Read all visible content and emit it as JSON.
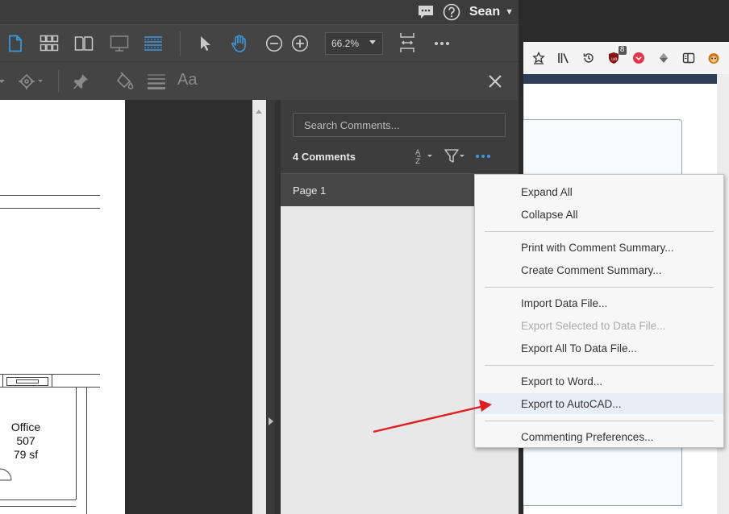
{
  "topbar": {
    "user_name": "Sean",
    "comment_icon": "speech-bubble-icon",
    "help_icon": "help-question-icon"
  },
  "toolbar": {
    "zoom": "66.2%",
    "aa_label": "Aa"
  },
  "document": {
    "room_name": "Office",
    "room_number": "507",
    "room_area": "79 sf"
  },
  "comments_panel": {
    "search_placeholder": "Search Comments...",
    "count_label": "4 Comments",
    "page_label": "Page 1"
  },
  "context_menu": {
    "groups": [
      [
        "Expand All",
        "Collapse All"
      ],
      [
        "Print with Comment Summary...",
        "Create Comment Summary..."
      ],
      [
        "Import Data File...",
        "Export Selected to Data File...",
        "Export All To Data File..."
      ],
      [
        "Export to Word...",
        "Export to AutoCAD..."
      ],
      [
        "Commenting Preferences..."
      ]
    ],
    "disabled_item": "Export Selected to Data File...",
    "highlighted_item": "Export to AutoCAD..."
  },
  "browser": {
    "badge_count": "8"
  },
  "colors": {
    "accent_blue": "#3b98e0",
    "annotation_arrow": "#e02020",
    "panel_dark": "#3d3d3d",
    "menu_bg": "#f7f7f7"
  }
}
